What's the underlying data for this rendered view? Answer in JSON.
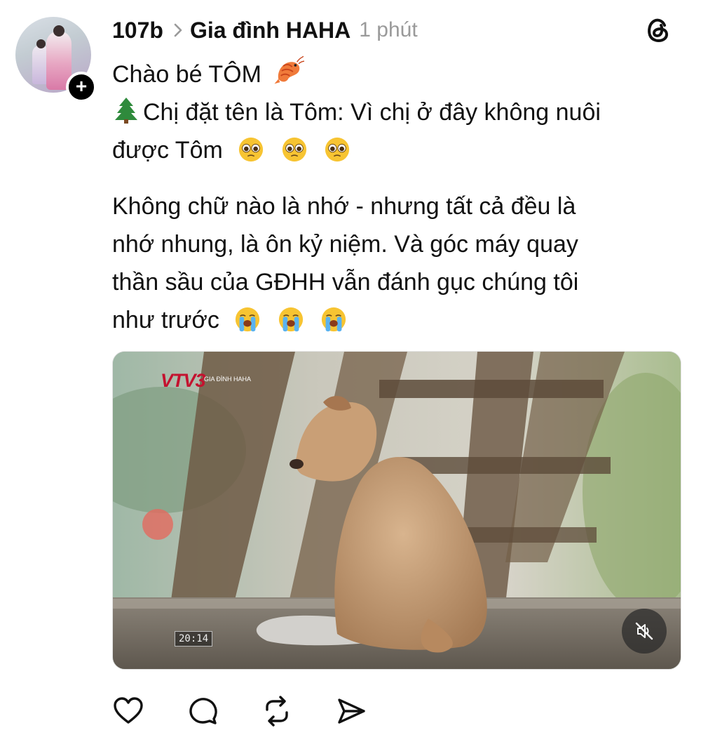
{
  "post": {
    "username": "107b",
    "community": "Gia đình HAHA",
    "time_ago": "1 phút",
    "lines": {
      "greeting": "Chào bé TÔM",
      "line2a": "Chị đặt tên là Tôm: Vì chị ở đây không nuôi",
      "line2b": "được Tôm",
      "para1": "Không chữ nào là nhớ - nhưng tất cả đều là",
      "para2": "nhớ nhung, là ôn kỷ niệm. Và góc máy quay",
      "para3": "thần sầu của GĐHH vẫn đánh gục chúng tôi",
      "para4": "như trước"
    },
    "emojis": {
      "shrimp": "shrimp-icon",
      "tree": "evergreen-tree-icon",
      "pleading": "pleading-face-icon",
      "crying": "loudly-crying-face-icon"
    }
  },
  "video": {
    "channel_logo": "VTV3",
    "channel_sub": "GIA ĐÌNH HAHA",
    "timestamp": "20:14",
    "muted": true
  },
  "actions": [
    "like",
    "comment",
    "repost",
    "share"
  ],
  "colors": {
    "text": "#111111",
    "time": "#9a9a9a",
    "vtv_red": "#c4122f",
    "background": "#ffffff"
  }
}
